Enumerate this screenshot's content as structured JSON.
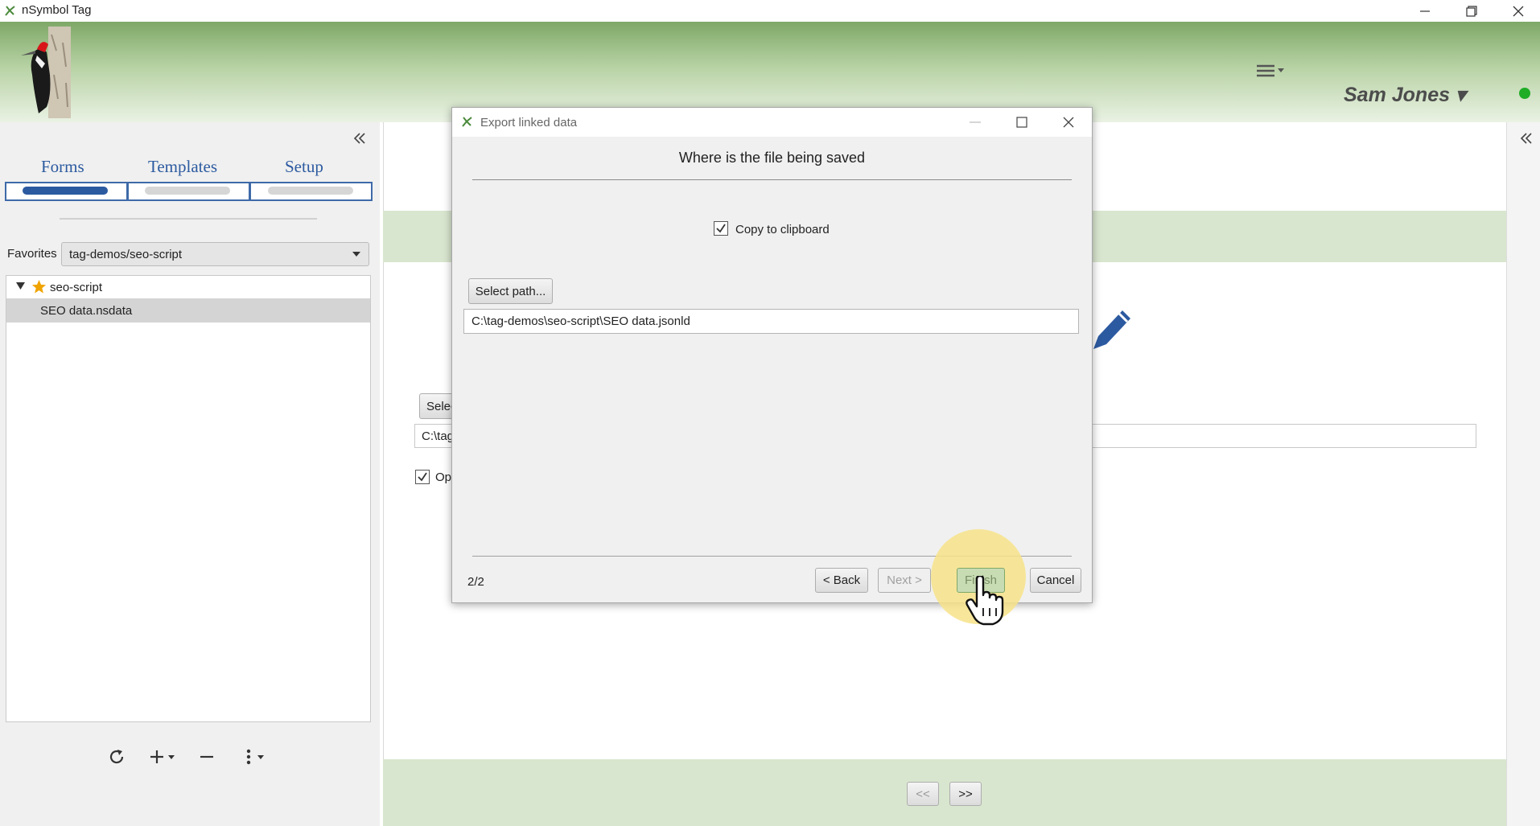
{
  "window": {
    "title": "nSymbol Tag",
    "controls": [
      "minimize-icon",
      "restore-icon",
      "close-icon"
    ]
  },
  "header": {
    "menu_icon": "hamburger-menu-icon",
    "user_name": "Sam Jones ▾",
    "status_color": "#1fad26"
  },
  "left_panel": {
    "tabs": [
      {
        "label": "Forms",
        "active": true
      },
      {
        "label": "Templates",
        "active": false
      },
      {
        "label": "Setup",
        "active": false
      }
    ],
    "favorites_label": "Favorites",
    "favorites_value": "tag-demos/seo-script",
    "tree": [
      {
        "label": "seo-script",
        "icon": "star-icon",
        "expanded": true
      },
      {
        "label": "SEO data.nsdata",
        "selected": true
      }
    ],
    "toolbar": [
      "refresh-icon",
      "add-icon",
      "remove-icon",
      "more-icon"
    ]
  },
  "main": {
    "select_button_partial": "Selec",
    "path_partial": "C:\\tag",
    "checkbox_partial": "Op",
    "nav_prev": "<<",
    "nav_next": ">>"
  },
  "dialog": {
    "title": "Export linked data",
    "heading": "Where is the file being saved",
    "copy_label": "Copy to clipboard",
    "copy_checked": true,
    "select_path_label": "Select path...",
    "path_value": "C:\\tag-demos\\seo-script\\SEO data.jsonld",
    "step": "2/2",
    "back_label": "< Back",
    "next_label": "Next >",
    "finish_label": "Finish",
    "cancel_label": "Cancel"
  },
  "colors": {
    "accent": "#2c5aa0",
    "header_green": "#7ea867",
    "band_green": "#d9e6cf",
    "pointer_highlight": "#f7e38a"
  }
}
